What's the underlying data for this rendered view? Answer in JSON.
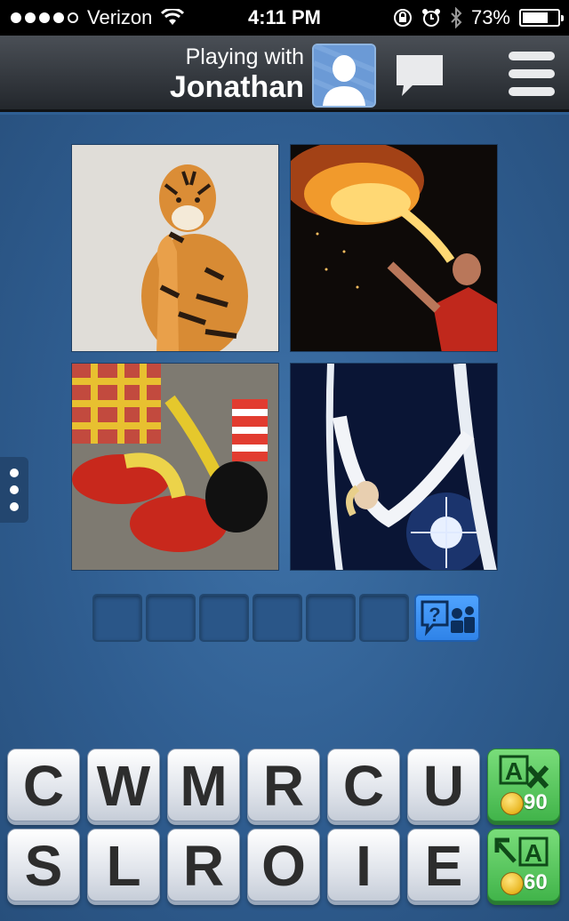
{
  "status_bar": {
    "carrier": "Verizon",
    "time": "4:11 PM",
    "battery": "73%",
    "battery_level": 0.73
  },
  "header": {
    "playing_with_label": "Playing with",
    "opponent_name": "Jonathan",
    "icons": {
      "avatar": "person-avatar-icon",
      "chat": "chat-bubble-icon",
      "menu": "hamburger-menu-icon"
    }
  },
  "puzzle": {
    "photos": [
      {
        "name": "photo-tiger"
      },
      {
        "name": "photo-fire-breather"
      },
      {
        "name": "photo-clown-shoes"
      },
      {
        "name": "photo-aerial-acrobat"
      }
    ],
    "answer_slots": 6,
    "help_button_icon": "ask-friend-icon"
  },
  "letters": {
    "row1": [
      "C",
      "W",
      "M",
      "R",
      "C",
      "U"
    ],
    "row2": [
      "S",
      "L",
      "R",
      "O",
      "I",
      "E"
    ]
  },
  "powerups": {
    "remove_letters": {
      "label": "A",
      "cost": "90",
      "icon": "remove-letter-icon"
    },
    "reveal_letter": {
      "label": "A",
      "cost": "60",
      "icon": "reveal-letter-icon"
    }
  },
  "colors": {
    "background": "#2f5f93",
    "header": "#2a2e33",
    "help_button": "#3a8ff2",
    "powerup": "#55c25a"
  }
}
